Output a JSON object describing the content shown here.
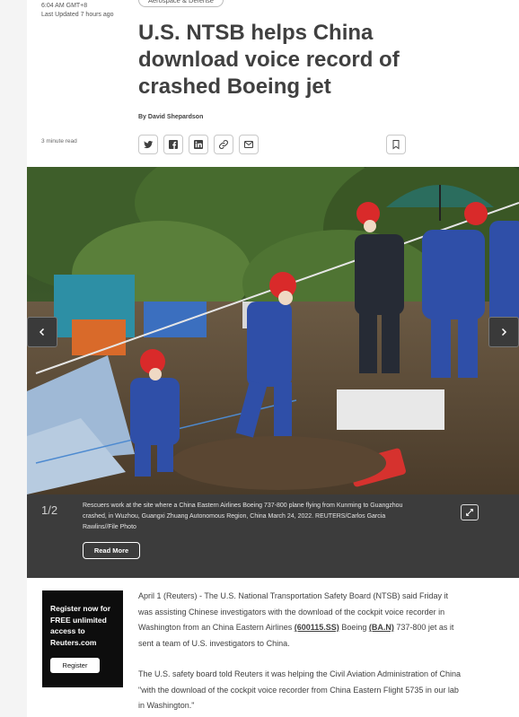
{
  "meta": {
    "published": "6:04 AM GMT+8",
    "updated": "Last Updated 7 hours ago",
    "category_tag": "Aerospace & Defense",
    "read_time": "3 minute read"
  },
  "article": {
    "headline": "U.S. NTSB helps China download voice record of crashed Boeing jet",
    "byline": "By David Shepardson",
    "paragraph1_intro": "April 1 (Reuters) - The U.S. National Transportation Safety Board (NTSB) said Friday it was assisting Chinese investigators with the download of the cockpit voice recorder in Washington from an China Eastern Airlines ",
    "ticker1": "(600115.SS)",
    "paragraph1_mid": " Boeing ",
    "ticker2": "(BA.N)",
    "paragraph1_end": " 737-800 jet as it sent a team of U.S. investigators to China.",
    "paragraph2": "The U.S. safety board told Reuters it was helping the Civil Aviation Administration of China \"with the download of the cockpit voice recorder from China Eastern Flight 5735 in our lab in Washington.\""
  },
  "share": {
    "icons": [
      "twitter-icon",
      "facebook-icon",
      "linkedin-icon",
      "link-icon",
      "email-icon"
    ],
    "bookmark_icon": "bookmark-icon"
  },
  "gallery": {
    "counter": "1/2",
    "caption": "Rescuers work at the site where a China Eastern Airlines Boeing 737-800 plane flying from Kunming to Guangzhou crashed, in Wuzhou, Guangxi Zhuang Autonomous Region, China March 24, 2022. REUTERS/Carlos Garcia Rawlins//File Photo",
    "read_more": "Read More",
    "bg_color": "#3c3c3c"
  },
  "promo": {
    "text": "Register now for FREE unlimited access to Reuters.com",
    "button": "Register"
  },
  "colors": {
    "text": "#404040",
    "accent": "#fa6400",
    "promo_bg": "#0d0d0d"
  }
}
